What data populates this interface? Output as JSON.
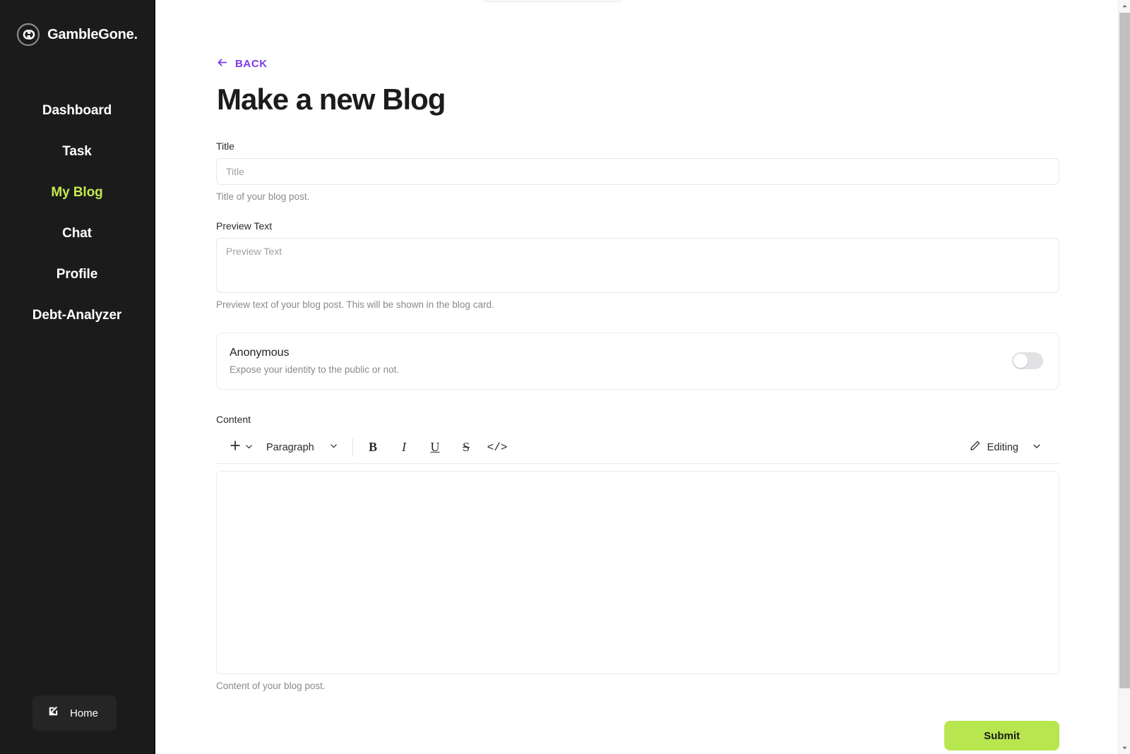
{
  "sidebar": {
    "brand": {
      "name": "GambleGone.",
      "logo_icon": "gamblegone-chain-logo-icon"
    },
    "items": [
      {
        "label": "Dashboard",
        "active": false
      },
      {
        "label": "Task",
        "active": false
      },
      {
        "label": "My Blog",
        "active": true
      },
      {
        "label": "Chat",
        "active": false
      },
      {
        "label": "Profile",
        "active": false
      },
      {
        "label": "Debt-Analyzer",
        "active": false
      }
    ],
    "home_button": {
      "label": "Home",
      "icon": "external-link-arrow-icon"
    },
    "active_color": "#c5e84f",
    "background_color": "#1b1b1b"
  },
  "main": {
    "back_link": {
      "label": "BACK",
      "icon": "arrow-left-icon",
      "color": "#7c3aed"
    },
    "page_title": "Make a new Blog",
    "fields": {
      "title": {
        "label": "Title",
        "value": "",
        "placeholder": "Title",
        "help": "Title of your blog post."
      },
      "preview_text": {
        "label": "Preview Text",
        "value": "",
        "placeholder": "Preview Text",
        "help": "Preview text of your blog post. This will be shown in the blog card."
      },
      "anonymous": {
        "title": "Anonymous",
        "description": "Expose your identity to the public or not.",
        "toggle_state": "off"
      },
      "content": {
        "label": "Content",
        "value": "",
        "help": "Content of your blog post."
      }
    },
    "editor_toolbar": {
      "insert": {
        "label": "+",
        "icon": "plus-icon",
        "chevron": "chevron-down-icon"
      },
      "block_type": {
        "selected": "Paragraph",
        "chevron": "chevron-down-icon"
      },
      "format_buttons": [
        {
          "name": "bold",
          "glyph": "B"
        },
        {
          "name": "italic",
          "glyph": "I"
        },
        {
          "name": "underline",
          "glyph": "U"
        },
        {
          "name": "strikethrough",
          "glyph": "S"
        },
        {
          "name": "code",
          "glyph": "</>"
        }
      ],
      "mode": {
        "label": "Editing",
        "icon": "pencil-icon",
        "chevron": "chevron-down-icon"
      }
    },
    "submit_button": {
      "label": "Submit",
      "color": "#b8e64f"
    }
  },
  "scrollbar": {
    "up_arrow": "scroll-up-arrow-icon",
    "down_arrow": "scroll-down-arrow-icon"
  }
}
